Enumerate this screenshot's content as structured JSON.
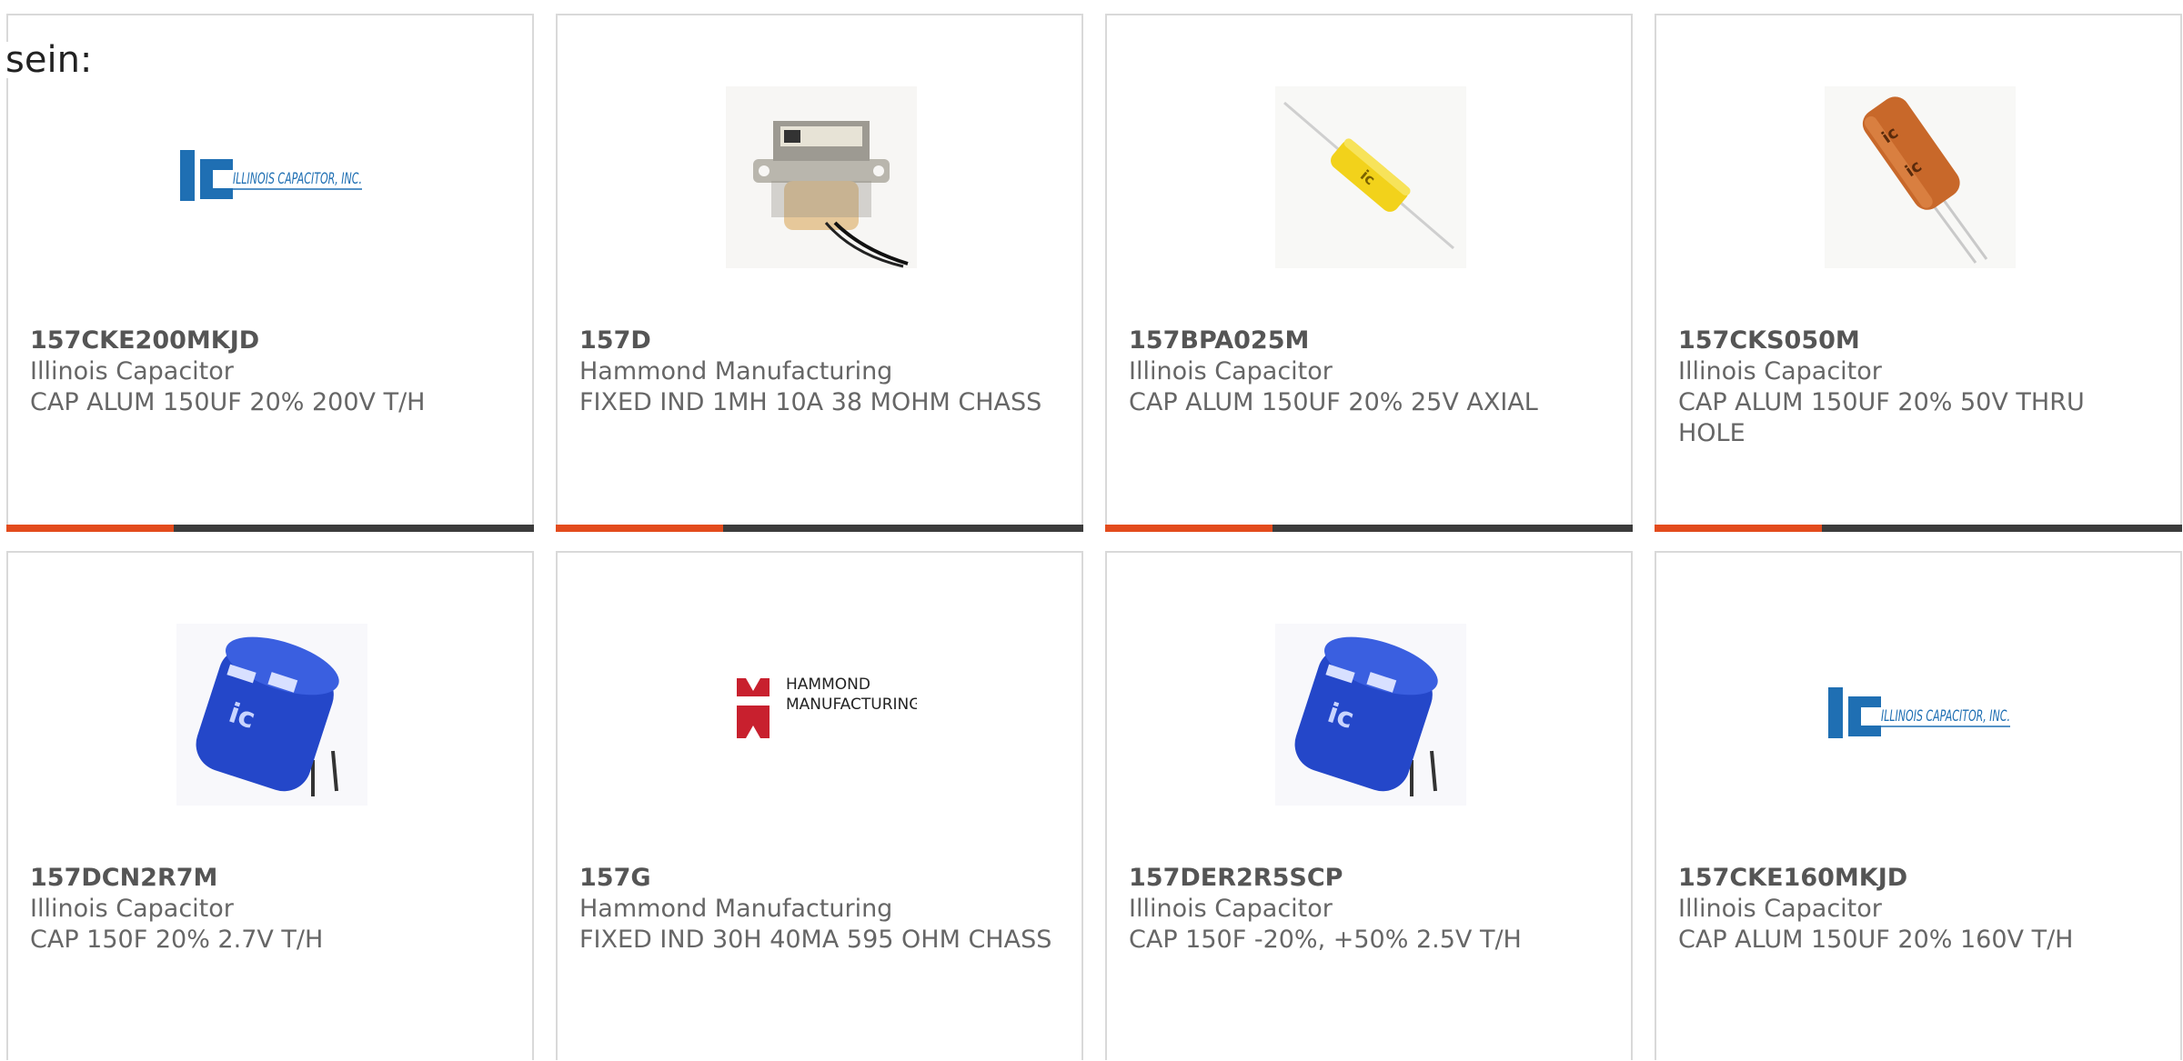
{
  "heading": "sein:",
  "colors": {
    "accent": "#e34b1d",
    "bar": "#3c3c3c",
    "card_border": "#d9d9d9",
    "part_text": "#555555",
    "body_text": "#666666",
    "ic_blue": "#1f6fb3",
    "hammond_red": "#c8202e",
    "supercap_blue": "#2447c9",
    "capacitor_yellow": "#f2d21b",
    "capacitor_orange": "#c8682a"
  },
  "products": [
    {
      "part": "157CKE200MKJD",
      "manufacturer": "Illinois Capacitor",
      "description": "CAP ALUM 150UF 20% 200V T/H",
      "image": "illinois-capacitor-logo",
      "logo_text": "ILLINOIS CAPACITOR, INC."
    },
    {
      "part": "157D",
      "manufacturer": "Hammond Manufacturing",
      "description": "FIXED IND 1MH 10A 38 MOHM CHASS",
      "image": "chassis-inductor-photo"
    },
    {
      "part": "157BPA025M",
      "manufacturer": "Illinois Capacitor",
      "description": "CAP ALUM 150UF 20% 25V AXIAL",
      "image": "axial-capacitor-photo"
    },
    {
      "part": "157CKS050M",
      "manufacturer": "Illinois Capacitor",
      "description": "CAP ALUM 150UF 20% 50V THRU HOLE",
      "image": "radial-capacitor-photo"
    },
    {
      "part": "157DCN2R7M",
      "manufacturer": "Illinois Capacitor",
      "description": "CAP 150F 20% 2.7V T/H",
      "image": "supercapacitor-photo"
    },
    {
      "part": "157G",
      "manufacturer": "Hammond Manufacturing",
      "description": "FIXED IND 30H 40MA 595 OHM CHASS",
      "image": "hammond-logo",
      "logo_text": [
        "HAMMOND",
        "MANUFACTURING."
      ]
    },
    {
      "part": "157DER2R5SCP",
      "manufacturer": "Illinois Capacitor",
      "description": "CAP 150F -20%, +50% 2.5V T/H",
      "image": "supercapacitor-photo"
    },
    {
      "part": "157CKE160MKJD",
      "manufacturer": "Illinois Capacitor",
      "description": "CAP ALUM 150UF 20% 160V T/H",
      "image": "illinois-capacitor-logo",
      "logo_text": "ILLINOIS CAPACITOR, INC."
    }
  ]
}
